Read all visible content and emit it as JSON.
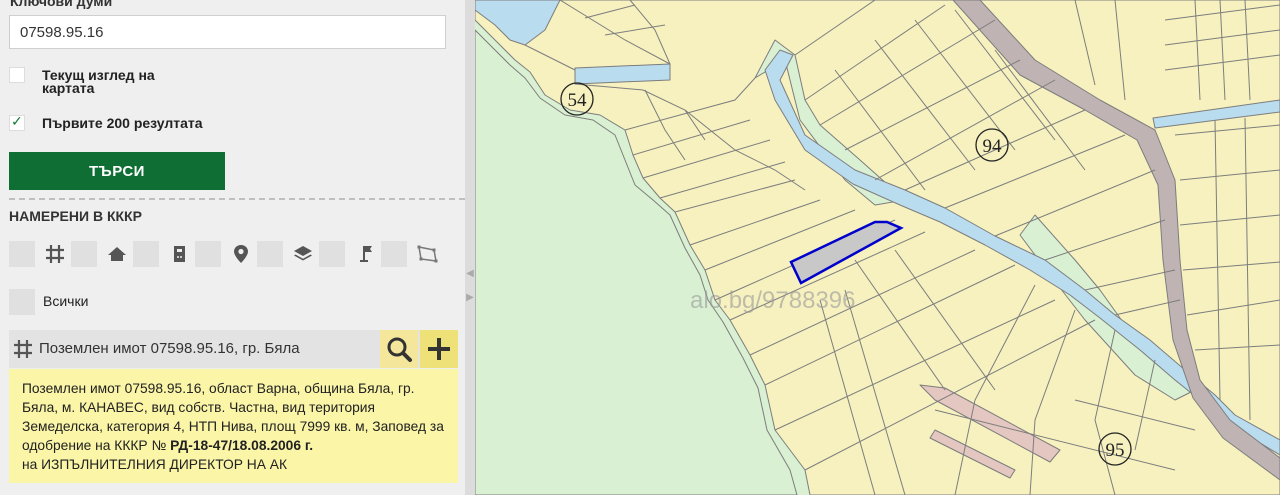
{
  "panel": {
    "keywords_label": "Ключови думи",
    "keyword_value": "07598.95.16",
    "current_view_label": "Текущ изглед на картата",
    "first_200_label": "Първите 200 резултата",
    "first_200_checked": true,
    "search_button": "ТЪРСИ",
    "found_header": "НАМЕРЕНИ В КККР",
    "filters": [
      "parcel-grid-icon",
      "building-icon",
      "apartment-icon",
      "location-pin-icon",
      "layers-icon",
      "flag-icon",
      "polygon-icon"
    ],
    "all_label": "Всички",
    "result": {
      "title": "Поземлен имот 07598.95.16, гр. Бяла",
      "info_text": "Поземлен имот 07598.95.16, област Варна, община Бяла, гр. Бяла, м. КАНАВЕС, вид собств. Частна, вид територия Земеделска, категория 4, НТП Нива, площ 7999 кв. м, Заповед за одобрение на КККР №",
      "order": "РД-18-47/18.08.2006 г.",
      "issuer": "на ИЗПЪЛНИТЕЛНИЯ ДИРЕКТОР НА АК"
    }
  },
  "map": {
    "watermark": "alo.bg/9788396",
    "block_labels": [
      "54",
      "94",
      "95"
    ],
    "colors": {
      "parcel_fill": "#f6f1bf",
      "parcel_line": "#7d7d7d",
      "green_area": "#d9f0d3",
      "water": "#b9dcee",
      "road": "#bfb3b3",
      "selected_outline": "#0000cc",
      "selected_fill": "#c8c8c8",
      "search_button": "#0f6e34",
      "info_background": "#faf5a7"
    }
  }
}
